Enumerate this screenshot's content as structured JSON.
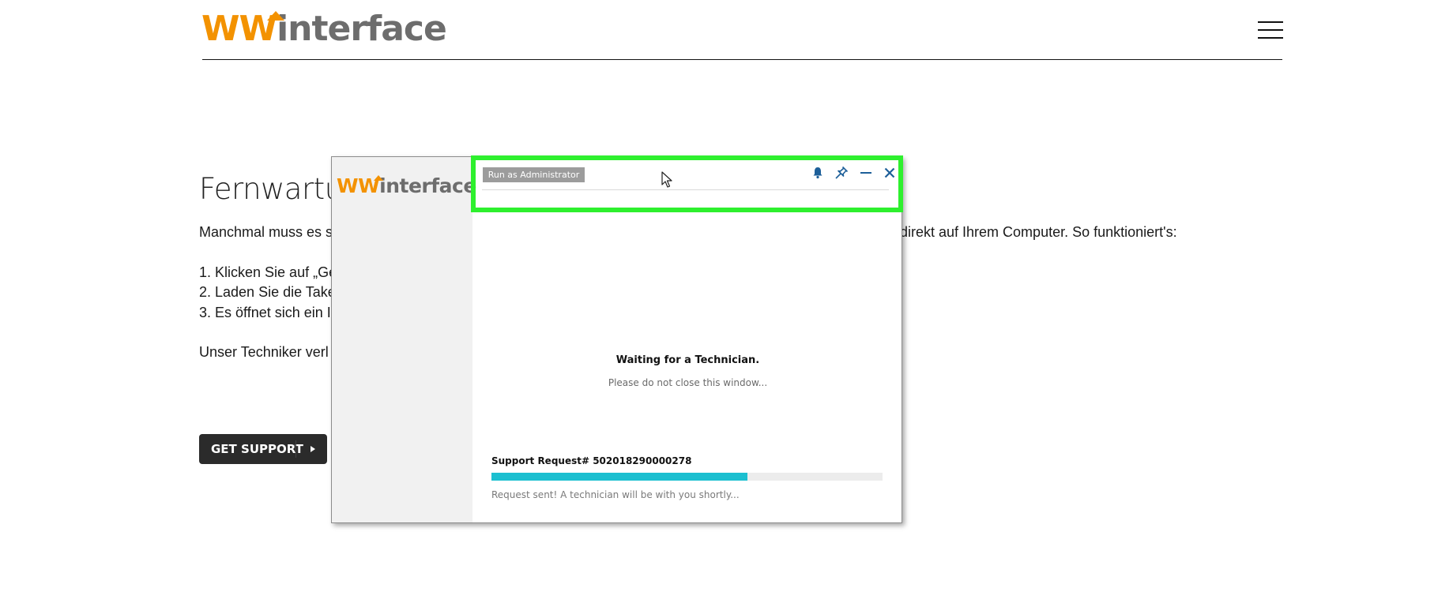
{
  "header": {
    "logo": {
      "ww": "WW",
      "rest": "interface"
    },
    "menu_icon": "hamburger-menu-icon"
  },
  "content": {
    "heading": "Fernwartur",
    "lines": [
      "Manchmal muss es s",
      "direkt auf Ihrem Computer. So funktioniert's:",
      "1. Klicken Sie auf „Ge",
      "2. Laden Sie die Take",
      "3. Es öffnet sich ein I",
      "Unser Techniker verl"
    ],
    "get_support_label": "GET SUPPORT",
    "get_support_icon": "play-triangle-icon"
  },
  "dialog": {
    "logo": {
      "ww": "WW",
      "rest": "interface"
    },
    "run_as_admin_label": "Run as Administrator",
    "icons": [
      "bell-icon",
      "pin-icon",
      "minimize-icon",
      "close-icon"
    ],
    "status_title": "Waiting for a Technician.",
    "status_subtitle": "Please do not close this window...",
    "request_label": "Support Request# 502018290000278",
    "progress_fraction": 0.655,
    "request_status": "Request sent! A technician will be with you shortly...",
    "colors": {
      "progress": "#1cbfd0",
      "icon_blue": "#1d5f99",
      "logo_orange": "#f39200"
    }
  },
  "overlay": {
    "highlight_color": "#2ef02e",
    "cursor_icon": "mouse-pointer-icon"
  }
}
